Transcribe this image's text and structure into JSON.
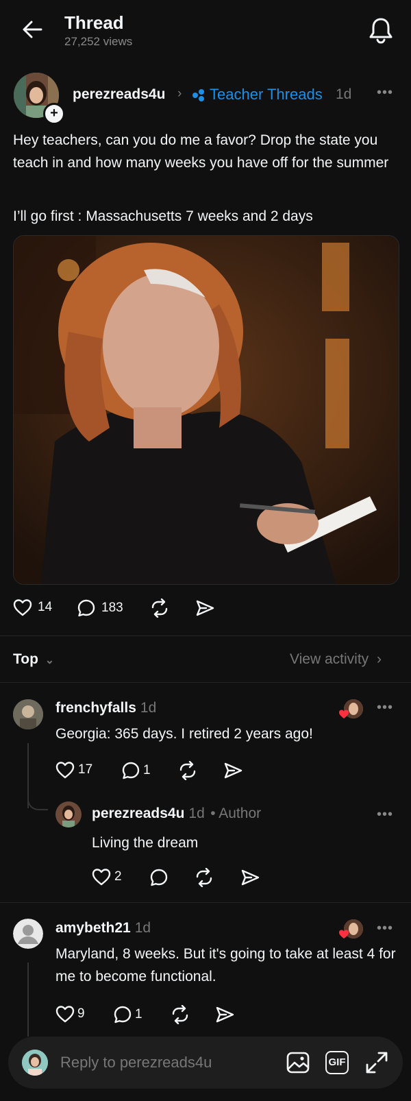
{
  "header": {
    "title": "Thread",
    "views": "27,252 views"
  },
  "post": {
    "username": "perezreads4u",
    "community": "Teacher Threads",
    "time": "1d",
    "text_1": "Hey teachers, can you do me a favor? Drop the state you teach in and how many weeks you have off for the summer",
    "text_2": "I’ll go first : Massachusetts 7 weeks and 2 days",
    "likes": "14",
    "replies": "183"
  },
  "sort": {
    "label": "Top",
    "view_activity": "View activity"
  },
  "comments": [
    {
      "username": "frenchyfalls",
      "time": "1d",
      "text": "Georgia: 365 days. I retired 2 years ago!",
      "likes": "17",
      "replies": "1",
      "reply": {
        "username": "perezreads4u",
        "time": "1d",
        "author_tag": "• Author",
        "text": "Living the dream",
        "likes": "2"
      }
    },
    {
      "username": "amybeth21",
      "time": "1d",
      "text": "Maryland, 8 weeks. But it's going to take at least 4 for me to become functional.",
      "likes": "9",
      "replies": "1"
    }
  ],
  "reply_bar": {
    "placeholder": "Reply to perezreads4u",
    "gif_label": "GIF"
  },
  "colors": {
    "background": "#101010",
    "accent_blue": "#1f8fe5",
    "like_red": "#ff3040"
  }
}
